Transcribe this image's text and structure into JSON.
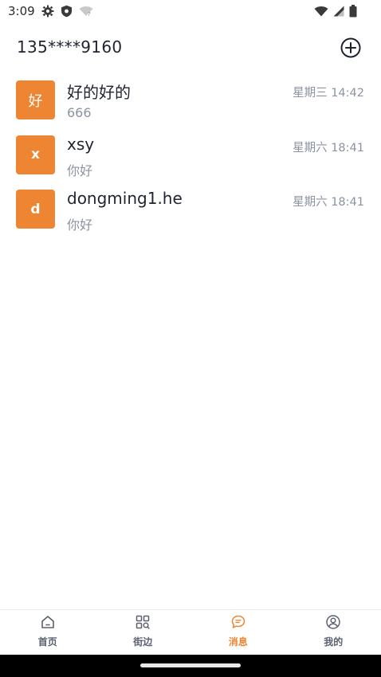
{
  "status_bar": {
    "time": "3:09",
    "icons": [
      "gear-icon",
      "shield-icon",
      "wifi-off-icon",
      "wifi-icon",
      "cell-signal-icon",
      "battery-icon"
    ]
  },
  "header": {
    "title": "135****9160",
    "add_icon": "plus-circle-icon"
  },
  "conversations": [
    {
      "avatar": "好",
      "name": "好的好的",
      "preview": "666",
      "time": "星期三 14:42"
    },
    {
      "avatar": "x",
      "name": "xsy",
      "preview": "你好",
      "time": "星期六 18:41"
    },
    {
      "avatar": "d",
      "name": "dongming1.he",
      "preview": "你好",
      "time": "星期六 18:41"
    }
  ],
  "tabs": [
    {
      "label": "首页",
      "icon": "home-icon",
      "active": false
    },
    {
      "label": "街边",
      "icon": "grid-search-icon",
      "active": false
    },
    {
      "label": "消息",
      "icon": "chat-bubble-icon",
      "active": true
    },
    {
      "label": "我的",
      "icon": "user-circle-icon",
      "active": false
    }
  ],
  "colors": {
    "accent": "#ee8532",
    "text_primary": "#1f2430",
    "text_secondary": "#8c93a2"
  }
}
